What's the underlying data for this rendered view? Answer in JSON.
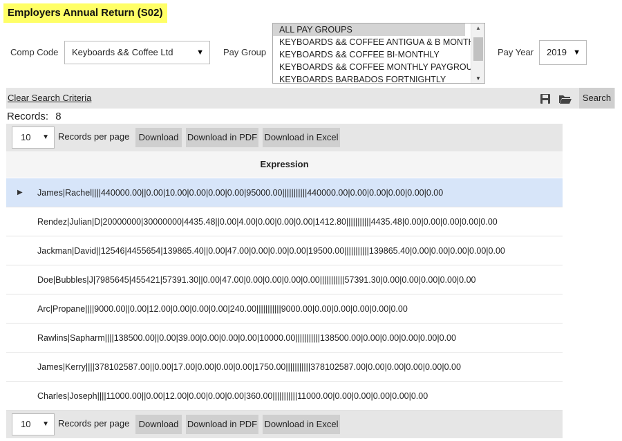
{
  "page": {
    "title": "Employers Annual Return (S02)"
  },
  "filters": {
    "comp_code_label": "Comp Code",
    "comp_code_value": "Keyboards && Coffee Ltd",
    "pay_group_label": "Pay Group",
    "pay_group_options": [
      "ALL PAY GROUPS",
      "KEYBOARDS && COFFEE ANTIGUA & B MONTHLY",
      "KEYBOARDS && COFFEE BI-MONTHLY",
      "KEYBOARDS && COFFEE MONTHLY PAYGROUP",
      "KEYBOARDS BARBADOS FORTNIGHTLY"
    ],
    "pay_group_selected": "ALL PAY GROUPS",
    "pay_year_label": "Pay Year",
    "pay_year_value": "2019"
  },
  "searchbar": {
    "clear_label": "Clear Search Criteria",
    "search_label": "Search",
    "save_icon": "save-icon",
    "open_icon": "folder-open-icon"
  },
  "records": {
    "label": "Records:",
    "count": "8"
  },
  "pager": {
    "page_size": "10",
    "per_page_label": "Records per page",
    "download_label": "Download",
    "download_pdf_label": "Download in PDF",
    "download_excel_label": "Download in Excel"
  },
  "grid": {
    "column_header": "Expression",
    "rows": [
      "James|Rachel||||440000.00||0.00|10.00|0.00|0.00|0.00|95000.00|||||||||||440000.00|0.00|0.00|0.00|0.00|0.00",
      "Rendez|Julian|D|20000000|30000000|4435.48||0.00|4.00|0.00|0.00|0.00|1412.80|||||||||||4435.48|0.00|0.00|0.00|0.00|0.00",
      "Jackman|David||12546|4455654|139865.40||0.00|47.00|0.00|0.00|0.00|19500.00|||||||||||139865.40|0.00|0.00|0.00|0.00|0.00",
      "Doe|Bubbles|J|7985645|455421|57391.30||0.00|47.00|0.00|0.00|0.00|0.00|||||||||||57391.30|0.00|0.00|0.00|0.00|0.00",
      "Arc|Propane||||9000.00||0.00|12.00|0.00|0.00|0.00|240.00|||||||||||9000.00|0.00|0.00|0.00|0.00|0.00",
      "Rawlins|Sapharm||||138500.00||0.00|39.00|0.00|0.00|0.00|10000.00|||||||||||138500.00|0.00|0.00|0.00|0.00|0.00",
      "James|Kerry||||378102587.00||0.00|17.00|0.00|0.00|0.00|1750.00|||||||||||378102587.00|0.00|0.00|0.00|0.00|0.00",
      "Charles|Joseph||||11000.00||0.00|12.00|0.00|0.00|0.00|360.00|||||||||||11000.00|0.00|0.00|0.00|0.00|0.00"
    ],
    "selected_row": 0
  },
  "colors": {
    "title_highlight": "#ffff66",
    "selected_row": "#d7e5f9",
    "toolbar_bg": "#e6e6e6",
    "button_bg": "#cfcfcf"
  }
}
